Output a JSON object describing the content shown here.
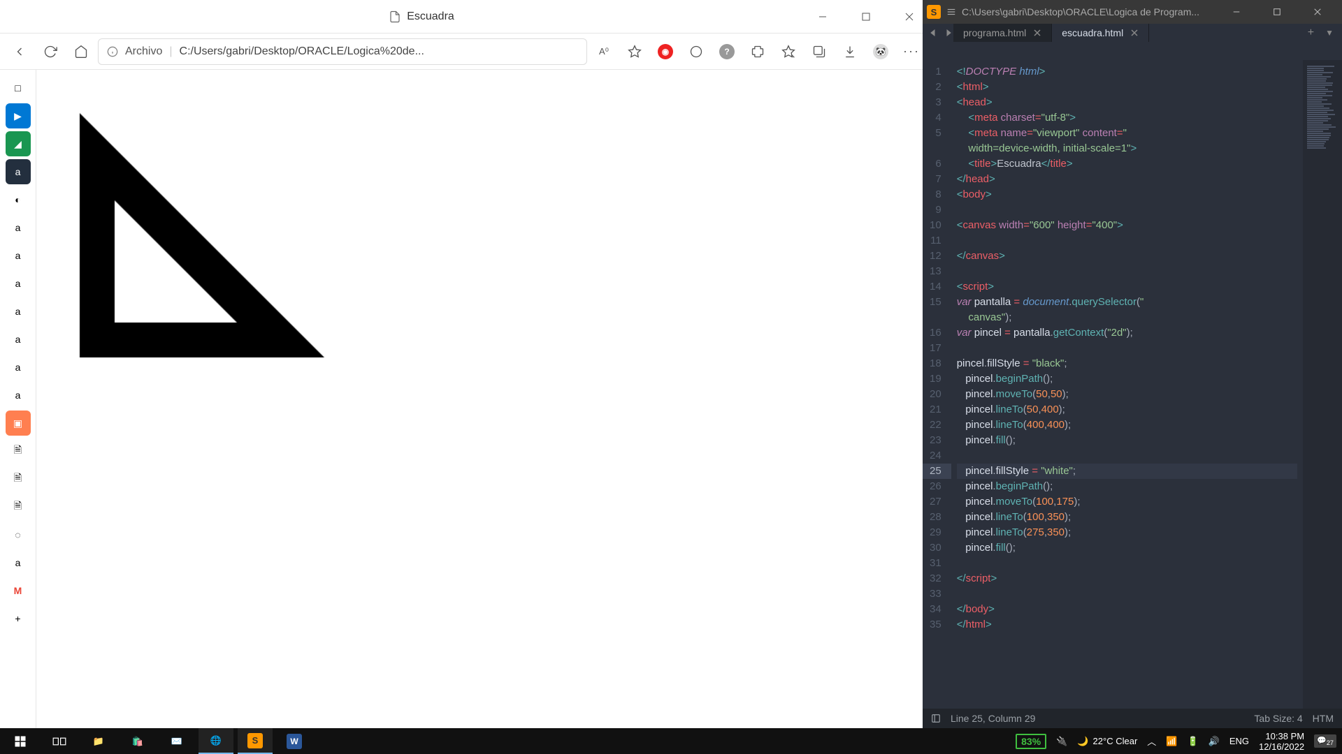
{
  "browser": {
    "title": "Escuadra",
    "address_label": "Archivo",
    "address_path": "C:/Users/gabri/Desktop/ORACLE/Logica%20de...",
    "zoom_badge": "83%"
  },
  "sidebar_items": [
    "□",
    "▶",
    "◢",
    "a",
    "◐",
    "a",
    "a",
    "a",
    "a",
    "a",
    "a",
    "a",
    "▣",
    "🗎",
    "🗎",
    "🗎",
    "◌",
    "a",
    "M",
    "+"
  ],
  "editor": {
    "title_path": "C:\\Users\\gabri\\Desktop\\ORACLE\\Logica de Program...",
    "tabs": [
      {
        "name": "programa.html",
        "active": false
      },
      {
        "name": "escuadra.html",
        "active": true
      }
    ],
    "status_left": "Line 25, Column 29",
    "status_tab": "Tab Size: 4",
    "status_lang": "HTM",
    "highlighted_line": 25,
    "lines": [
      {
        "n": 1,
        "html": "<span class='c-brkt'>&lt;!</span><span class='c-doc'>DOCTYPE</span> <span class='c-docn'>html</span><span class='c-brkt'>&gt;</span>"
      },
      {
        "n": 2,
        "html": "<span class='c-brkt'>&lt;</span><span class='c-tag'>html</span><span class='c-brkt'>&gt;</span>"
      },
      {
        "n": 3,
        "html": "<span class='c-brkt'>&lt;</span><span class='c-tag'>head</span><span class='c-brkt'>&gt;</span>"
      },
      {
        "n": 4,
        "html": "    <span class='c-brkt'>&lt;</span><span class='c-tag'>meta</span> <span class='c-attr'>charset</span><span class='c-op'>=</span><span class='c-str'>\"utf-8\"</span><span class='c-brkt'>&gt;</span>"
      },
      {
        "n": 5,
        "html": "    <span class='c-brkt'>&lt;</span><span class='c-tag'>meta</span> <span class='c-attr'>name</span><span class='c-op'>=</span><span class='c-str'>\"viewport\"</span> <span class='c-attr'>content</span><span class='c-op'>=</span><span class='c-str'>\"</span>\n    <span class='c-str'>width=device-width, initial-scale=1\"</span><span class='c-brkt'>&gt;</span>"
      },
      {
        "n": 6,
        "html": "    <span class='c-brkt'>&lt;</span><span class='c-tag'>title</span><span class='c-brkt'>&gt;</span>Escuadra<span class='c-brkt'>&lt;/</span><span class='c-tag'>title</span><span class='c-brkt'>&gt;</span>"
      },
      {
        "n": 7,
        "html": "<span class='c-brkt'>&lt;/</span><span class='c-tag'>head</span><span class='c-brkt'>&gt;</span>"
      },
      {
        "n": 8,
        "html": "<span class='c-brkt'>&lt;</span><span class='c-tag'>body</span><span class='c-brkt'>&gt;</span>"
      },
      {
        "n": 9,
        "html": ""
      },
      {
        "n": 10,
        "html": "<span class='c-brkt'>&lt;</span><span class='c-tag'>canvas</span> <span class='c-attr'>width</span><span class='c-op'>=</span><span class='c-str'>\"600\"</span> <span class='c-attr'>height</span><span class='c-op'>=</span><span class='c-str'>\"400\"</span><span class='c-brkt'>&gt;</span>"
      },
      {
        "n": 11,
        "html": ""
      },
      {
        "n": 12,
        "html": "<span class='c-brkt'>&lt;/</span><span class='c-tag'>canvas</span><span class='c-brkt'>&gt;</span>"
      },
      {
        "n": 13,
        "html": ""
      },
      {
        "n": 14,
        "html": "<span class='c-brkt'>&lt;</span><span class='c-tag'>script</span><span class='c-brkt'>&gt;</span>"
      },
      {
        "n": 15,
        "html": "<span class='c-kw'>var</span> <span class='c-var'>pantalla</span> <span class='c-op'>=</span> <span class='c-obj'>document</span><span class='c-punc'>.</span><span class='c-func'>querySelector</span><span class='c-punc'>(</span><span class='c-str'>\"</span>\n    <span class='c-str'>canvas\"</span><span class='c-punc'>);</span>"
      },
      {
        "n": 16,
        "html": "<span class='c-kw'>var</span> <span class='c-var'>pincel</span> <span class='c-op'>=</span> <span class='c-var'>pantalla</span><span class='c-punc'>.</span><span class='c-func'>getContext</span><span class='c-punc'>(</span><span class='c-str'>\"2d\"</span><span class='c-punc'>);</span>"
      },
      {
        "n": 17,
        "html": ""
      },
      {
        "n": 18,
        "html": "<span class='c-var'>pincel</span><span class='c-punc'>.</span><span class='c-var'>fillStyle</span> <span class='c-op'>=</span> <span class='c-str'>\"black\"</span><span class='c-punc'>;</span>"
      },
      {
        "n": 19,
        "html": "   <span class='c-var'>pincel</span><span class='c-punc'>.</span><span class='c-func'>beginPath</span><span class='c-punc'>();</span>"
      },
      {
        "n": 20,
        "html": "   <span class='c-var'>pincel</span><span class='c-punc'>.</span><span class='c-func'>moveTo</span><span class='c-punc'>(</span><span class='c-num'>50</span><span class='c-punc'>,</span><span class='c-num'>50</span><span class='c-punc'>);</span>"
      },
      {
        "n": 21,
        "html": "   <span class='c-var'>pincel</span><span class='c-punc'>.</span><span class='c-func'>lineTo</span><span class='c-punc'>(</span><span class='c-num'>50</span><span class='c-punc'>,</span><span class='c-num'>400</span><span class='c-punc'>);</span>"
      },
      {
        "n": 22,
        "html": "   <span class='c-var'>pincel</span><span class='c-punc'>.</span><span class='c-func'>lineTo</span><span class='c-punc'>(</span><span class='c-num'>400</span><span class='c-punc'>,</span><span class='c-num'>400</span><span class='c-punc'>);</span>"
      },
      {
        "n": 23,
        "html": "   <span class='c-var'>pincel</span><span class='c-punc'>.</span><span class='c-func'>fill</span><span class='c-punc'>();</span>"
      },
      {
        "n": 24,
        "html": ""
      },
      {
        "n": 25,
        "html": "   <span class='c-var'>pincel</span><span class='c-punc'>.</span><span class='c-var'>fillStyle</span> <span class='c-op'>=</span> <span class='c-str'>\"white\"</span><span class='c-punc'>;</span>"
      },
      {
        "n": 26,
        "html": "   <span class='c-var'>pincel</span><span class='c-punc'>.</span><span class='c-func'>beginPath</span><span class='c-punc'>();</span>"
      },
      {
        "n": 27,
        "html": "   <span class='c-var'>pincel</span><span class='c-punc'>.</span><span class='c-func'>moveTo</span><span class='c-punc'>(</span><span class='c-num'>100</span><span class='c-punc'>,</span><span class='c-num'>175</span><span class='c-punc'>);</span>"
      },
      {
        "n": 28,
        "html": "   <span class='c-var'>pincel</span><span class='c-punc'>.</span><span class='c-func'>lineTo</span><span class='c-punc'>(</span><span class='c-num'>100</span><span class='c-punc'>,</span><span class='c-num'>350</span><span class='c-punc'>);</span>"
      },
      {
        "n": 29,
        "html": "   <span class='c-var'>pincel</span><span class='c-punc'>.</span><span class='c-func'>lineTo</span><span class='c-punc'>(</span><span class='c-num'>275</span><span class='c-punc'>,</span><span class='c-num'>350</span><span class='c-punc'>);</span>"
      },
      {
        "n": 30,
        "html": "   <span class='c-var'>pincel</span><span class='c-punc'>.</span><span class='c-func'>fill</span><span class='c-punc'>();</span>"
      },
      {
        "n": 31,
        "html": ""
      },
      {
        "n": 32,
        "html": "<span class='c-brkt'>&lt;/</span><span class='c-tag'>script</span><span class='c-brkt'>&gt;</span>"
      },
      {
        "n": 33,
        "html": ""
      },
      {
        "n": 34,
        "html": "<span class='c-brkt'>&lt;/</span><span class='c-tag'>body</span><span class='c-brkt'>&gt;</span>"
      },
      {
        "n": 35,
        "html": "<span class='c-brkt'>&lt;/</span><span class='c-tag'>html</span><span class='c-brkt'>&gt;</span>"
      }
    ]
  },
  "taskbar": {
    "weather": "22°C  Clear",
    "lang": "ENG",
    "time": "10:38 PM",
    "date": "12/16/2022",
    "notif_count": "27"
  }
}
